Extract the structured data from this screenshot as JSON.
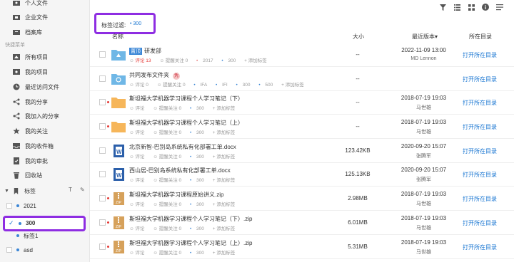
{
  "sidebar": {
    "top_items": [
      {
        "label": "个人文件",
        "icon": "person-folder-icon"
      },
      {
        "label": "企业文件",
        "icon": "enterprise-folder-icon"
      },
      {
        "label": "档案库",
        "icon": "archive-icon"
      }
    ],
    "section_label": "快捷菜单",
    "menu_items": [
      {
        "label": "所有项目",
        "icon": "all-projects-icon"
      },
      {
        "label": "我的项目",
        "icon": "my-projects-icon"
      },
      {
        "label": "最近访问文件",
        "icon": "clock-icon"
      },
      {
        "label": "我的分享",
        "icon": "share-icon"
      },
      {
        "label": "我加入的分享",
        "icon": "joined-share-icon"
      },
      {
        "label": "我的关注",
        "icon": "star-icon"
      },
      {
        "label": "我的收件箱",
        "icon": "inbox-icon"
      },
      {
        "label": "我的审批",
        "icon": "approval-icon"
      },
      {
        "label": "回收站",
        "icon": "trash-icon"
      }
    ],
    "tags_label": "标签",
    "tags": [
      {
        "label": "2021",
        "color": "#3b86d6"
      },
      {
        "label": "300",
        "color": "#3b86d6",
        "selected": true
      },
      {
        "label": "标签1",
        "color": "#3b86d6"
      },
      {
        "label": "asd",
        "color": "#3b86d6"
      }
    ]
  },
  "toolbar": {
    "icons": [
      "filter-icon",
      "list-view-icon",
      "grid-view-icon",
      "info-icon",
      "menu-icon"
    ]
  },
  "filter": {
    "label": "标签过滤:",
    "value": "300"
  },
  "table": {
    "headers": {
      "name": "名称",
      "size": "大小",
      "version": "最近版本▾",
      "dir": "所在目录"
    },
    "rows": [
      {
        "name": "研发部",
        "type": "team-folder",
        "top_badge": "置顶",
        "meta": [
          "评论 13",
          "提醒关注 0",
          "2017",
          "300",
          "添加标签"
        ],
        "size": "--",
        "date": "2022-11-09 13:00",
        "user": "MD Lennon",
        "open": "打开所在目录",
        "red_dot": false
      },
      {
        "name": "共同发布文件夹",
        "type": "shared-folder",
        "lock": "凭",
        "meta": [
          "评论 0",
          "提醒关注 0",
          "IFA",
          "IFI",
          "300",
          "500",
          "添加标签"
        ],
        "size": "--",
        "date": "",
        "user": "",
        "open": "打开所在目录",
        "red_dot": false
      },
      {
        "name": "斯坦福大学机器学习课程个人学习笔记（下）",
        "type": "folder",
        "meta": [
          "评论",
          "提醒关注 0",
          "300",
          "添加标签"
        ],
        "size": "--",
        "date": "2018-07-19 19:03",
        "user": "马世雄",
        "open": "打开所在目录",
        "red_dot": true
      },
      {
        "name": "斯坦福大学机器学习课程个人学习笔记（上）",
        "type": "folder",
        "meta": [
          "评论",
          "提醒关注 0",
          "300",
          "添加标签"
        ],
        "size": "--",
        "date": "2018-07-19 19:03",
        "user": "马世雄",
        "open": "打开所在目录",
        "red_dot": true
      },
      {
        "name": "北京新智-巴別岛系统私有化部署工单.docx",
        "type": "docx",
        "meta": [
          "评论",
          "提醒关注 0",
          "300",
          "添加标签"
        ],
        "size": "123.42KB",
        "date": "2020-09-20 15:07",
        "user": "张腾军",
        "open": "打开所在目录",
        "red_dot": false
      },
      {
        "name": "西山居-巴别岛系统私有化部署工单.docx",
        "type": "docx",
        "meta": [
          "评论",
          "提醒关注 0",
          "300",
          "添加标签"
        ],
        "size": "125.13KB",
        "date": "2020-09-20 15:07",
        "user": "张腾军",
        "open": "打开所在目录",
        "red_dot": false
      },
      {
        "name": "斯坦福大学机器学习课程原始讲义.zip",
        "type": "zip",
        "meta": [
          "评论",
          "提醒关注 0",
          "300",
          "添加标签"
        ],
        "size": "2.98MB",
        "date": "2018-07-19 19:03",
        "user": "马世雄",
        "open": "打开所在目录",
        "red_dot": true
      },
      {
        "name": "斯坦福大学机器学习课程个人学习笔记（下）.zip",
        "type": "zip",
        "meta": [
          "评论",
          "提醒关注 0",
          "300",
          "添加标签"
        ],
        "size": "6.01MB",
        "date": "2018-07-19 19:03",
        "user": "马世雄",
        "open": "打开所在目录",
        "red_dot": true
      },
      {
        "name": "斯坦福大学机器学习课程个人学习笔记（上）.zip",
        "type": "zip",
        "meta": [
          "评论",
          "提醒关注 0",
          "300",
          "添加标签"
        ],
        "size": "5.31MB",
        "date": "2018-07-19 19:03",
        "user": "马世雄",
        "open": "打开所在目录",
        "red_dot": true
      }
    ]
  },
  "colors": {
    "accent": "#1976d2",
    "highlight": "#8e2de2",
    "folder": "#f6b65a",
    "zip": "#d6a15b",
    "docx": "#2b5faa",
    "team": "#6fb7e6"
  }
}
